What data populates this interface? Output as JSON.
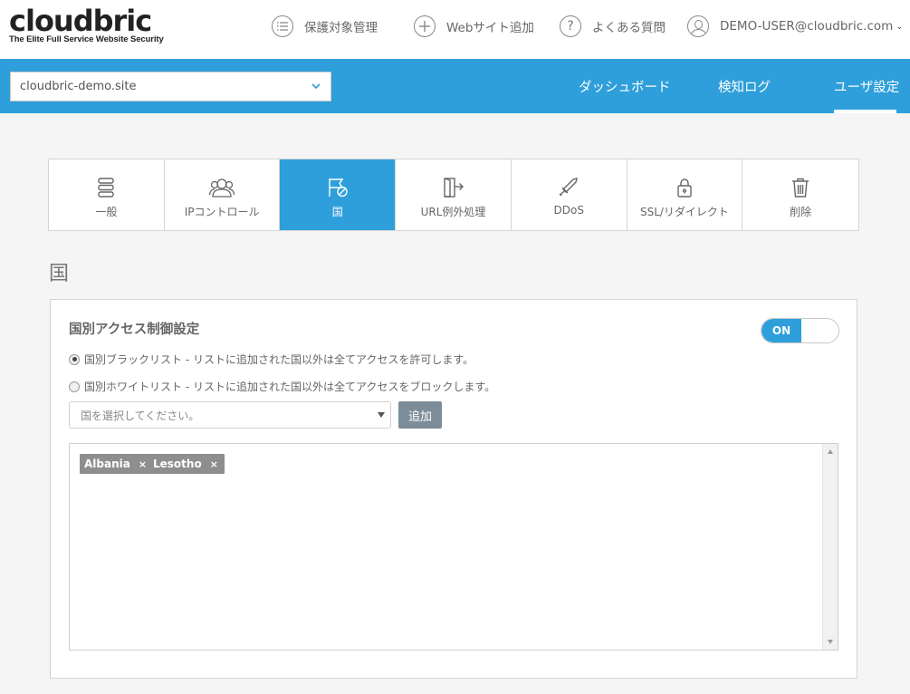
{
  "brand": {
    "logo_text": "cloudbric",
    "tagline": "The Elite Full Service Website Security"
  },
  "top_nav": {
    "protected_targets": "保護対象管理",
    "add_website": "Webサイト追加",
    "faq": "よくある質問",
    "user": "DEMO-USER@cloudbric.com"
  },
  "blue_bar": {
    "site_selected": "cloudbric-demo.site",
    "nav": {
      "dashboard": "ダッシュボード",
      "detection_log": "検知ログ",
      "user_settings": "ユーザ設定"
    },
    "active_nav": "user_settings"
  },
  "tabs": [
    {
      "label": "一般",
      "icon": "server-icon"
    },
    {
      "label": "IPコントロール",
      "icon": "users-icon"
    },
    {
      "label": "国",
      "icon": "flag-block-icon",
      "active": true
    },
    {
      "label": "URL例外処理",
      "icon": "door-exit-icon"
    },
    {
      "label": "DDoS",
      "icon": "sword-icon"
    },
    {
      "label": "SSL/リダイレクト",
      "icon": "lock-icon"
    },
    {
      "label": "削除",
      "icon": "trash-icon"
    }
  ],
  "section_title": "国",
  "panel": {
    "heading": "国別アクセス制御設定",
    "toggle_label": "ON",
    "toggle_on": true,
    "radio_blacklist": "国別ブラックリスト - リストに追加された国以外は全てアクセスを許可します。",
    "radio_whitelist": "国別ホワイトリスト - リストに追加された国以外は全てアクセスをブロックします。",
    "selected_mode": "blacklist",
    "country_placeholder": "国を選択してください。",
    "add_button": "追加",
    "tags": [
      {
        "label": "Albania",
        "remove": "×"
      },
      {
        "label": "Lesotho",
        "remove": "×"
      }
    ]
  },
  "colors": {
    "accent": "#2e9fda",
    "button_gray": "#7c8d99",
    "tag_gray": "#8e8e8e"
  }
}
